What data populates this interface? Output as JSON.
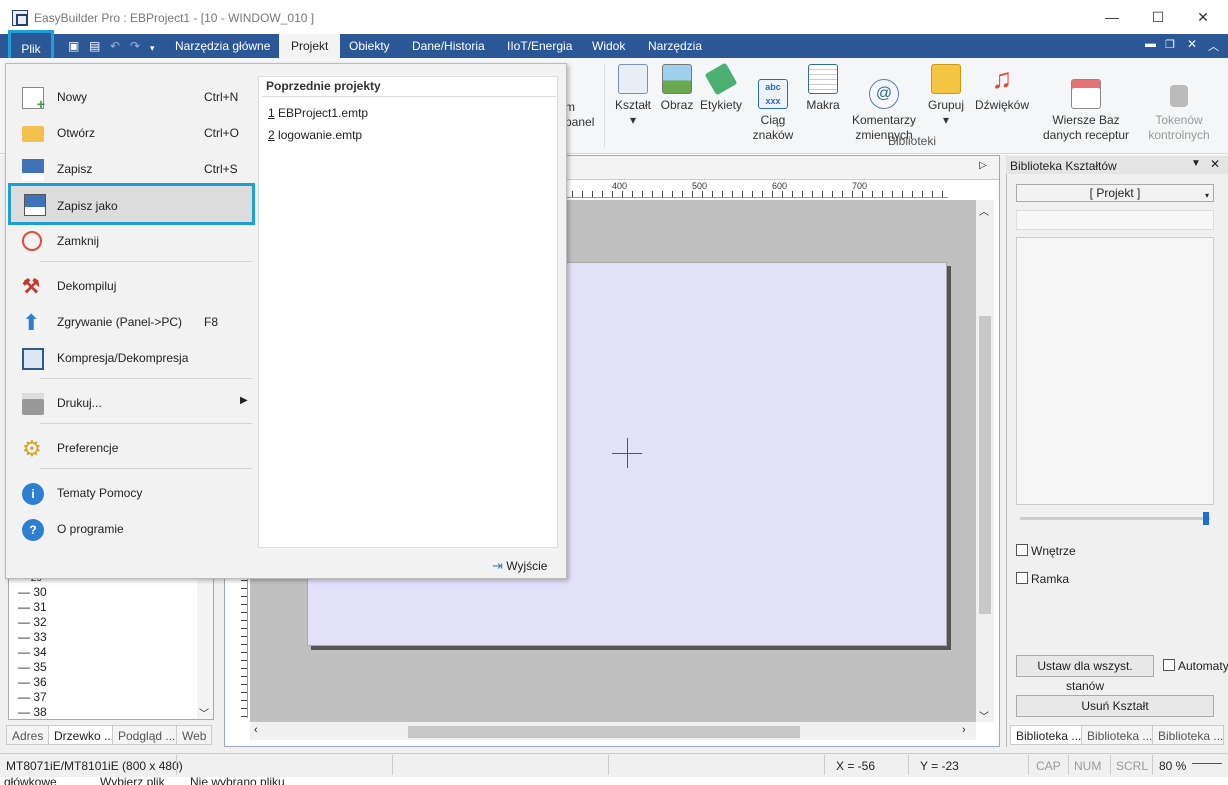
{
  "window": {
    "title": "EasyBuilder Pro : EBProject1 - [10 - WINDOW_010 ]",
    "minimize": "—",
    "maximize": "☐",
    "close": "✕"
  },
  "menubar": {
    "tabs": [
      "Plik",
      "Narzędzia główne",
      "Projekt",
      "Obiekty",
      "Dane/Historia",
      "IIoT/Energia",
      "Widok",
      "Narzędzia"
    ],
    "active_tab": "Projekt",
    "highlighted_tab": "Plik"
  },
  "ribbon": {
    "partial_label_1": "m",
    "partial_label_2": "panel",
    "buttons": [
      {
        "label": "Kształt",
        "icon": "shape-icon",
        "has_dropdown": true
      },
      {
        "label": "Obraz",
        "icon": "picture-icon"
      },
      {
        "label": "Etykiety",
        "icon": "tag-icon"
      },
      {
        "label": "Ciąg\nznaków",
        "icon": "abc-string-icon"
      },
      {
        "label": "Makra",
        "icon": "macro-icon"
      },
      {
        "label": "Komentarzy\nzmiennych",
        "icon": "at-comment-icon"
      },
      {
        "label": "Grupuj",
        "icon": "group-icon",
        "has_dropdown": true
      },
      {
        "label": "Dźwięków",
        "icon": "music-icon"
      },
      {
        "label": "Wiersze Baz\ndanych receptur",
        "icon": "recipe-db-icon"
      },
      {
        "label": "Tokenów\nkontrolnych",
        "icon": "lock-token-icon",
        "disabled": true
      }
    ],
    "group_label": "Biblioteki"
  },
  "file_menu": {
    "items": [
      {
        "label": "Nowy",
        "shortcut": "Ctrl+N",
        "icon": "new-file-icon"
      },
      {
        "label": "Otwórz",
        "shortcut": "Ctrl+O",
        "icon": "folder-open-icon"
      },
      {
        "label": "Zapisz",
        "shortcut": "Ctrl+S",
        "icon": "save-icon"
      },
      {
        "label": "Zapisz jako",
        "shortcut": "",
        "icon": "save-as-icon",
        "highlighted": true
      },
      {
        "label": "Zamknij",
        "shortcut": "",
        "icon": "power-icon"
      },
      {
        "label": "Dekompiluj",
        "shortcut": "",
        "icon": "decompile-icon"
      },
      {
        "label": "Zgrywanie (Panel->PC)",
        "shortcut": "F8",
        "icon": "upload-arrow-icon"
      },
      {
        "label": "Kompresja/Dekompresja",
        "shortcut": "",
        "icon": "compress-icon"
      },
      {
        "label": "Drukuj...",
        "shortcut": "",
        "icon": "printer-icon",
        "submenu": true
      },
      {
        "label": "Preferencje",
        "shortcut": "",
        "icon": "gears-icon"
      },
      {
        "label": "Tematy Pomocy",
        "shortcut": "",
        "icon": "info-icon"
      },
      {
        "label": "O programie",
        "shortcut": "",
        "icon": "question-icon"
      }
    ],
    "recent_title": "Poprzednie projekty",
    "recent": [
      {
        "num": "1",
        "name": "EBProject1.emtp"
      },
      {
        "num": "2",
        "name": "logowanie.emtp"
      }
    ],
    "exit_label": "Wyjście"
  },
  "ruler": {
    "labels": [
      "400",
      "500",
      "600",
      "700"
    ]
  },
  "tree": {
    "partial_top": "29",
    "rows": [
      "30",
      "31",
      "32",
      "33",
      "34",
      "35",
      "36",
      "37",
      "38"
    ],
    "tabs": [
      "Adres",
      "Drzewko ...",
      "Podgląd ...",
      "Web"
    ]
  },
  "right_panel": {
    "title": "Biblioteka Kształtów",
    "combo": "[ Projekt ]",
    "checkbox_interior": "Wnętrze",
    "checkbox_frame": "Ramka",
    "btn_set_all": "Ustaw dla wszyst. stanów",
    "checkbox_auto": "Automaty",
    "btn_remove": "Usuń Kształt",
    "tabs": [
      "Biblioteka ...",
      "Biblioteka ...",
      "Biblioteka ..."
    ]
  },
  "statusbar": {
    "model": "MT8071iE/MT8101iE (800 x 480)",
    "x": "X = -56",
    "y": "Y = -23",
    "cap": "CAP",
    "num": "NUM",
    "scrl": "SCRL",
    "zoom": "80 %"
  },
  "bottom_strip": {
    "t1": "główkowe",
    "t2": "Wybierz plik",
    "t3": "Nie wybrano pliku"
  }
}
